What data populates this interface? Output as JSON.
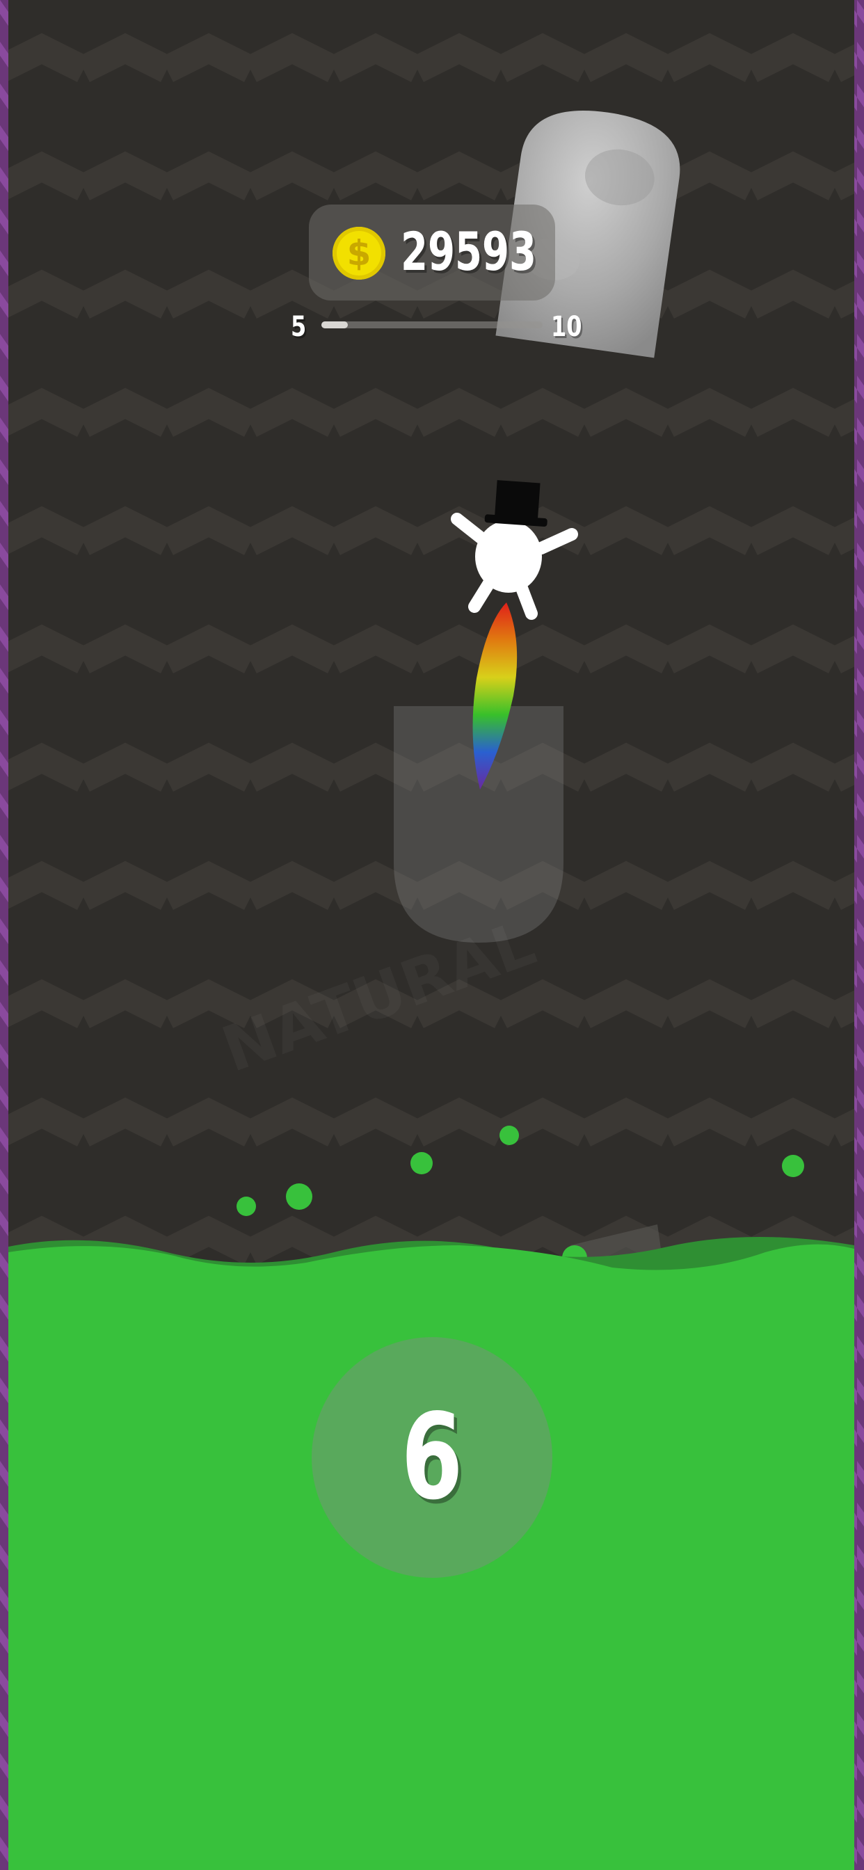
{
  "hud": {
    "coins": "29593",
    "level_current": "5",
    "level_next": "10",
    "level_progress": 0.12
  },
  "counter": {
    "value": "6"
  },
  "watermark": {
    "text": "NATURAL"
  },
  "colors": {
    "background": "#2f2d2a",
    "zigzag": "#3a3733",
    "side_border": "#7a3f8c",
    "acid": "#38c13c",
    "coin": "#f2e000"
  },
  "icons": {
    "coin": "coin-icon",
    "player": "snowman-top-hat",
    "obstacle": "tombstone"
  }
}
